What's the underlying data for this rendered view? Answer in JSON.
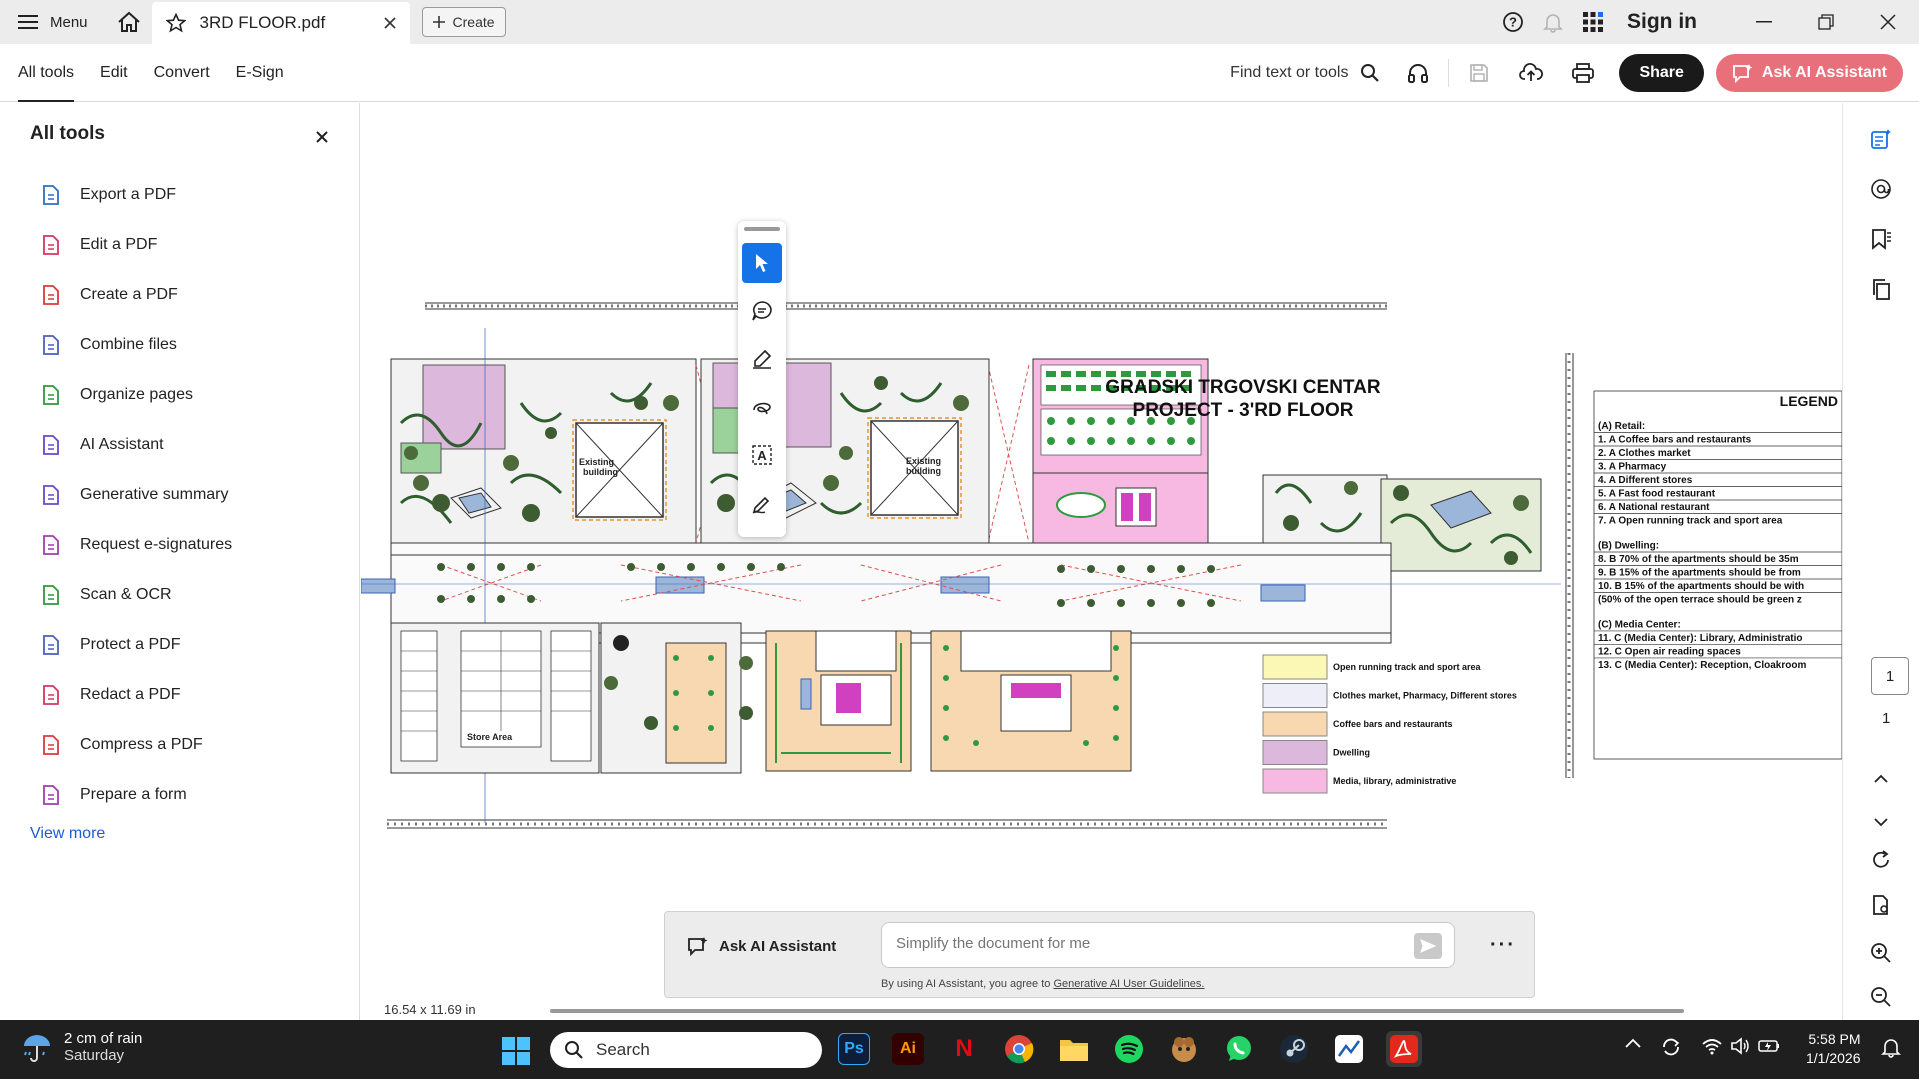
{
  "titlebar": {
    "menu_label": "Menu",
    "doc_tab": "3RD FLOOR.pdf",
    "create_label": "Create",
    "sign_in": "Sign in"
  },
  "toolbar": {
    "tabs": [
      "All tools",
      "Edit",
      "Convert",
      "E-Sign"
    ],
    "find_label": "Find text or tools",
    "share_label": "Share",
    "ai_label": "Ask AI Assistant"
  },
  "left_panel": {
    "title": "All tools",
    "items": [
      {
        "label": "Export a PDF",
        "icon": "export-pdf-icon",
        "color": "#2f6fc4"
      },
      {
        "label": "Edit a PDF",
        "icon": "edit-pdf-icon",
        "color": "#d3375f"
      },
      {
        "label": "Create a PDF",
        "icon": "create-pdf-icon",
        "color": "#d93a3a"
      },
      {
        "label": "Combine files",
        "icon": "combine-files-icon",
        "color": "#4a5fc1"
      },
      {
        "label": "Organize pages",
        "icon": "organize-pages-icon",
        "color": "#2e9a3d"
      },
      {
        "label": "AI Assistant",
        "icon": "ai-assistant-icon",
        "color": "#6a48c8"
      },
      {
        "label": "Generative summary",
        "icon": "generative-summary-icon",
        "color": "#6a48c8"
      },
      {
        "label": "Request e-signatures",
        "icon": "request-esign-icon",
        "color": "#a63ab1"
      },
      {
        "label": "Scan & OCR",
        "icon": "scan-ocr-icon",
        "color": "#2e9a3d"
      },
      {
        "label": "Protect a PDF",
        "icon": "protect-pdf-icon",
        "color": "#4a5fc1"
      },
      {
        "label": "Redact a PDF",
        "icon": "redact-pdf-icon",
        "color": "#d3375f"
      },
      {
        "label": "Compress a PDF",
        "icon": "compress-pdf-icon",
        "color": "#d93a3a"
      },
      {
        "label": "Prepare a form",
        "icon": "prepare-form-icon",
        "color": "#a63ab1"
      }
    ],
    "view_more": "View more"
  },
  "drawing": {
    "title_line1": "GRADSKI TRGOVSKI CENTAR",
    "title_line2": "PROJECT - 3'RD FLOOR",
    "existing_building": "Existing building",
    "store_area": "Store Area",
    "legend_title": "LEGEND",
    "legend_retail_header": "(A) Retail:",
    "legend_retail": [
      "1. A Coffee bars and restaurants",
      "2. A Clothes market",
      "3. A Pharmacy",
      "4. A Different stores",
      "5. A Fast food restaurant",
      "6. A National restaurant",
      "7. A Open running track and sport area"
    ],
    "legend_dwelling_header": "(B) Dwelling:",
    "legend_dwelling": [
      "8.  B 70% of the apartments should be 35m",
      "9.  B 15% of the apartments should be from",
      "10. B 15% of the apartments should be with",
      "(50% of the open terrace should be green z"
    ],
    "legend_media_header": "(C) Media Center:",
    "legend_media": [
      "11. C (Media Center): Library, Administratio",
      "12. C Open air reading spaces",
      "13. C (Media Center): Reception, Cloakroom"
    ],
    "color_key": [
      {
        "label": "Open running track and sport area",
        "color": "#fbf7b4"
      },
      {
        "label": "Clothes market, Pharmacy, Different stores",
        "color": "#eeeef8"
      },
      {
        "label": "Coffee bars and restaurants",
        "color": "#f8d8b0"
      },
      {
        "label": "Dwelling",
        "color": "#dcb8dc"
      },
      {
        "label": "Media, library, administrative",
        "color": "#f7b8e2"
      }
    ]
  },
  "status": {
    "page_size": "16.54 x 11.69 in",
    "page_current": "1",
    "page_total": "1"
  },
  "ai_bar": {
    "label": "Ask AI Assistant",
    "placeholder": "Simplify the document for me",
    "terms_prefix": "By using AI Assistant, you agree to ",
    "terms_link": "Generative AI User Guidelines."
  },
  "taskbar": {
    "weather_line1": "2 cm of rain",
    "weather_line2": "Saturday",
    "search_label": "Search",
    "time": "5:58 PM",
    "date": "1/1/2026"
  }
}
